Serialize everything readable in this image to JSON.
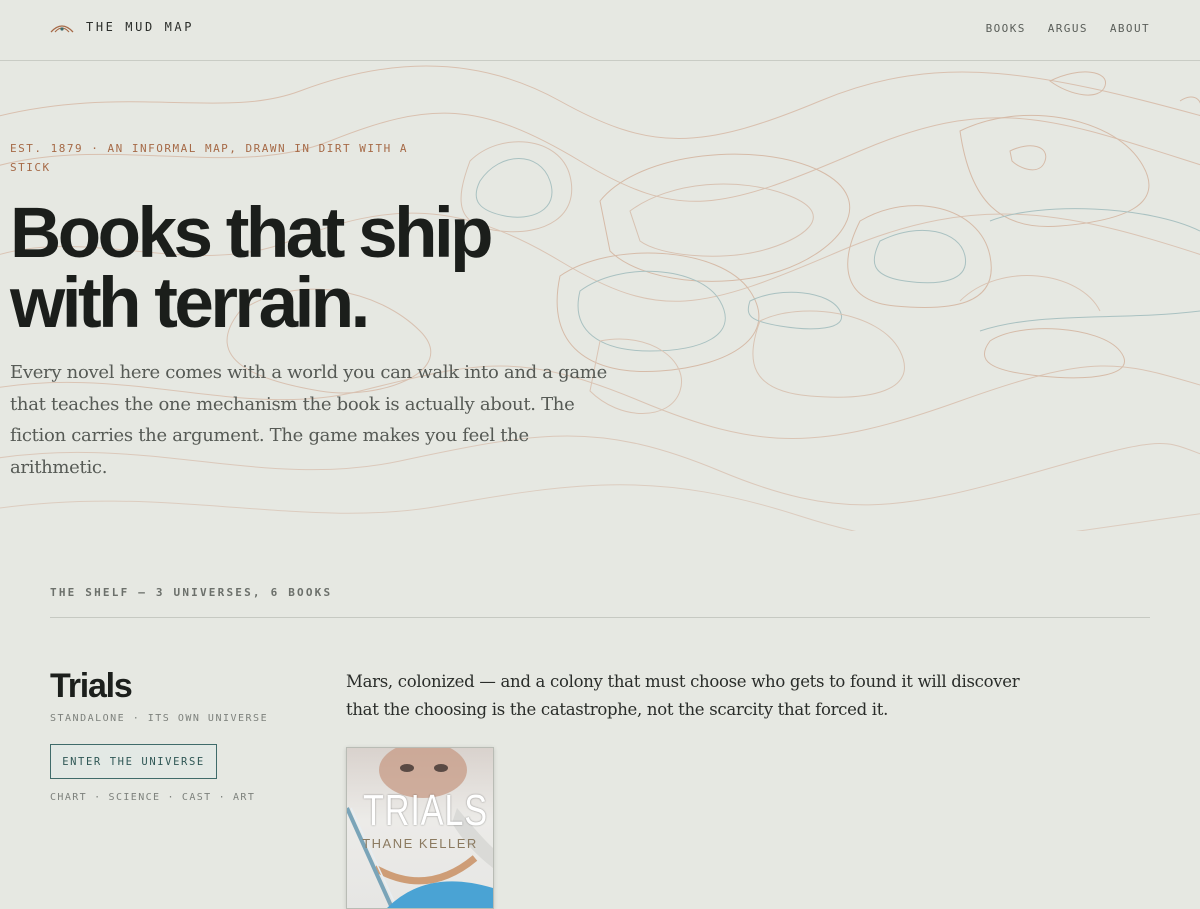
{
  "header": {
    "brand_name": "THE MUD MAP",
    "brand_icon": "mountain-sun-icon",
    "nav": [
      "BOOKS",
      "ARGUS",
      "ABOUT"
    ]
  },
  "hero": {
    "eyebrow": "EST. 1879 · AN INFORMAL MAP, DRAWN IN DIRT WITH A STICK",
    "headline": "Books that ship with terrain.",
    "lede": "Every novel here comes with a world you can walk into and a game that teaches the one mechanism the book is actually about. The fiction carries the argument. The game makes you feel the arithmetic."
  },
  "shelf": {
    "label": "THE SHELF — 3 UNIVERSES, 6 BOOKS",
    "books": [
      {
        "title": "Trials",
        "meta": "STANDALONE · ITS OWN UNIVERSE",
        "button": "ENTER THE UNIVERSE",
        "links": [
          "CHART",
          "SCIENCE",
          "CAST",
          "ART"
        ],
        "description": "Mars, colonized — and a colony that must choose who gets to found it will discover that the choosing is the catastrophe, not the scarcity that forced it.",
        "cover": {
          "title": "TRIALS",
          "author": "THANE KELLER"
        }
      }
    ]
  },
  "colors": {
    "background": "#e6e8e2",
    "accent_rust": "#a66a47",
    "accent_teal": "#3f6b6a",
    "contour_rust": "#d4b6a2",
    "contour_teal": "#a9c1c1"
  }
}
